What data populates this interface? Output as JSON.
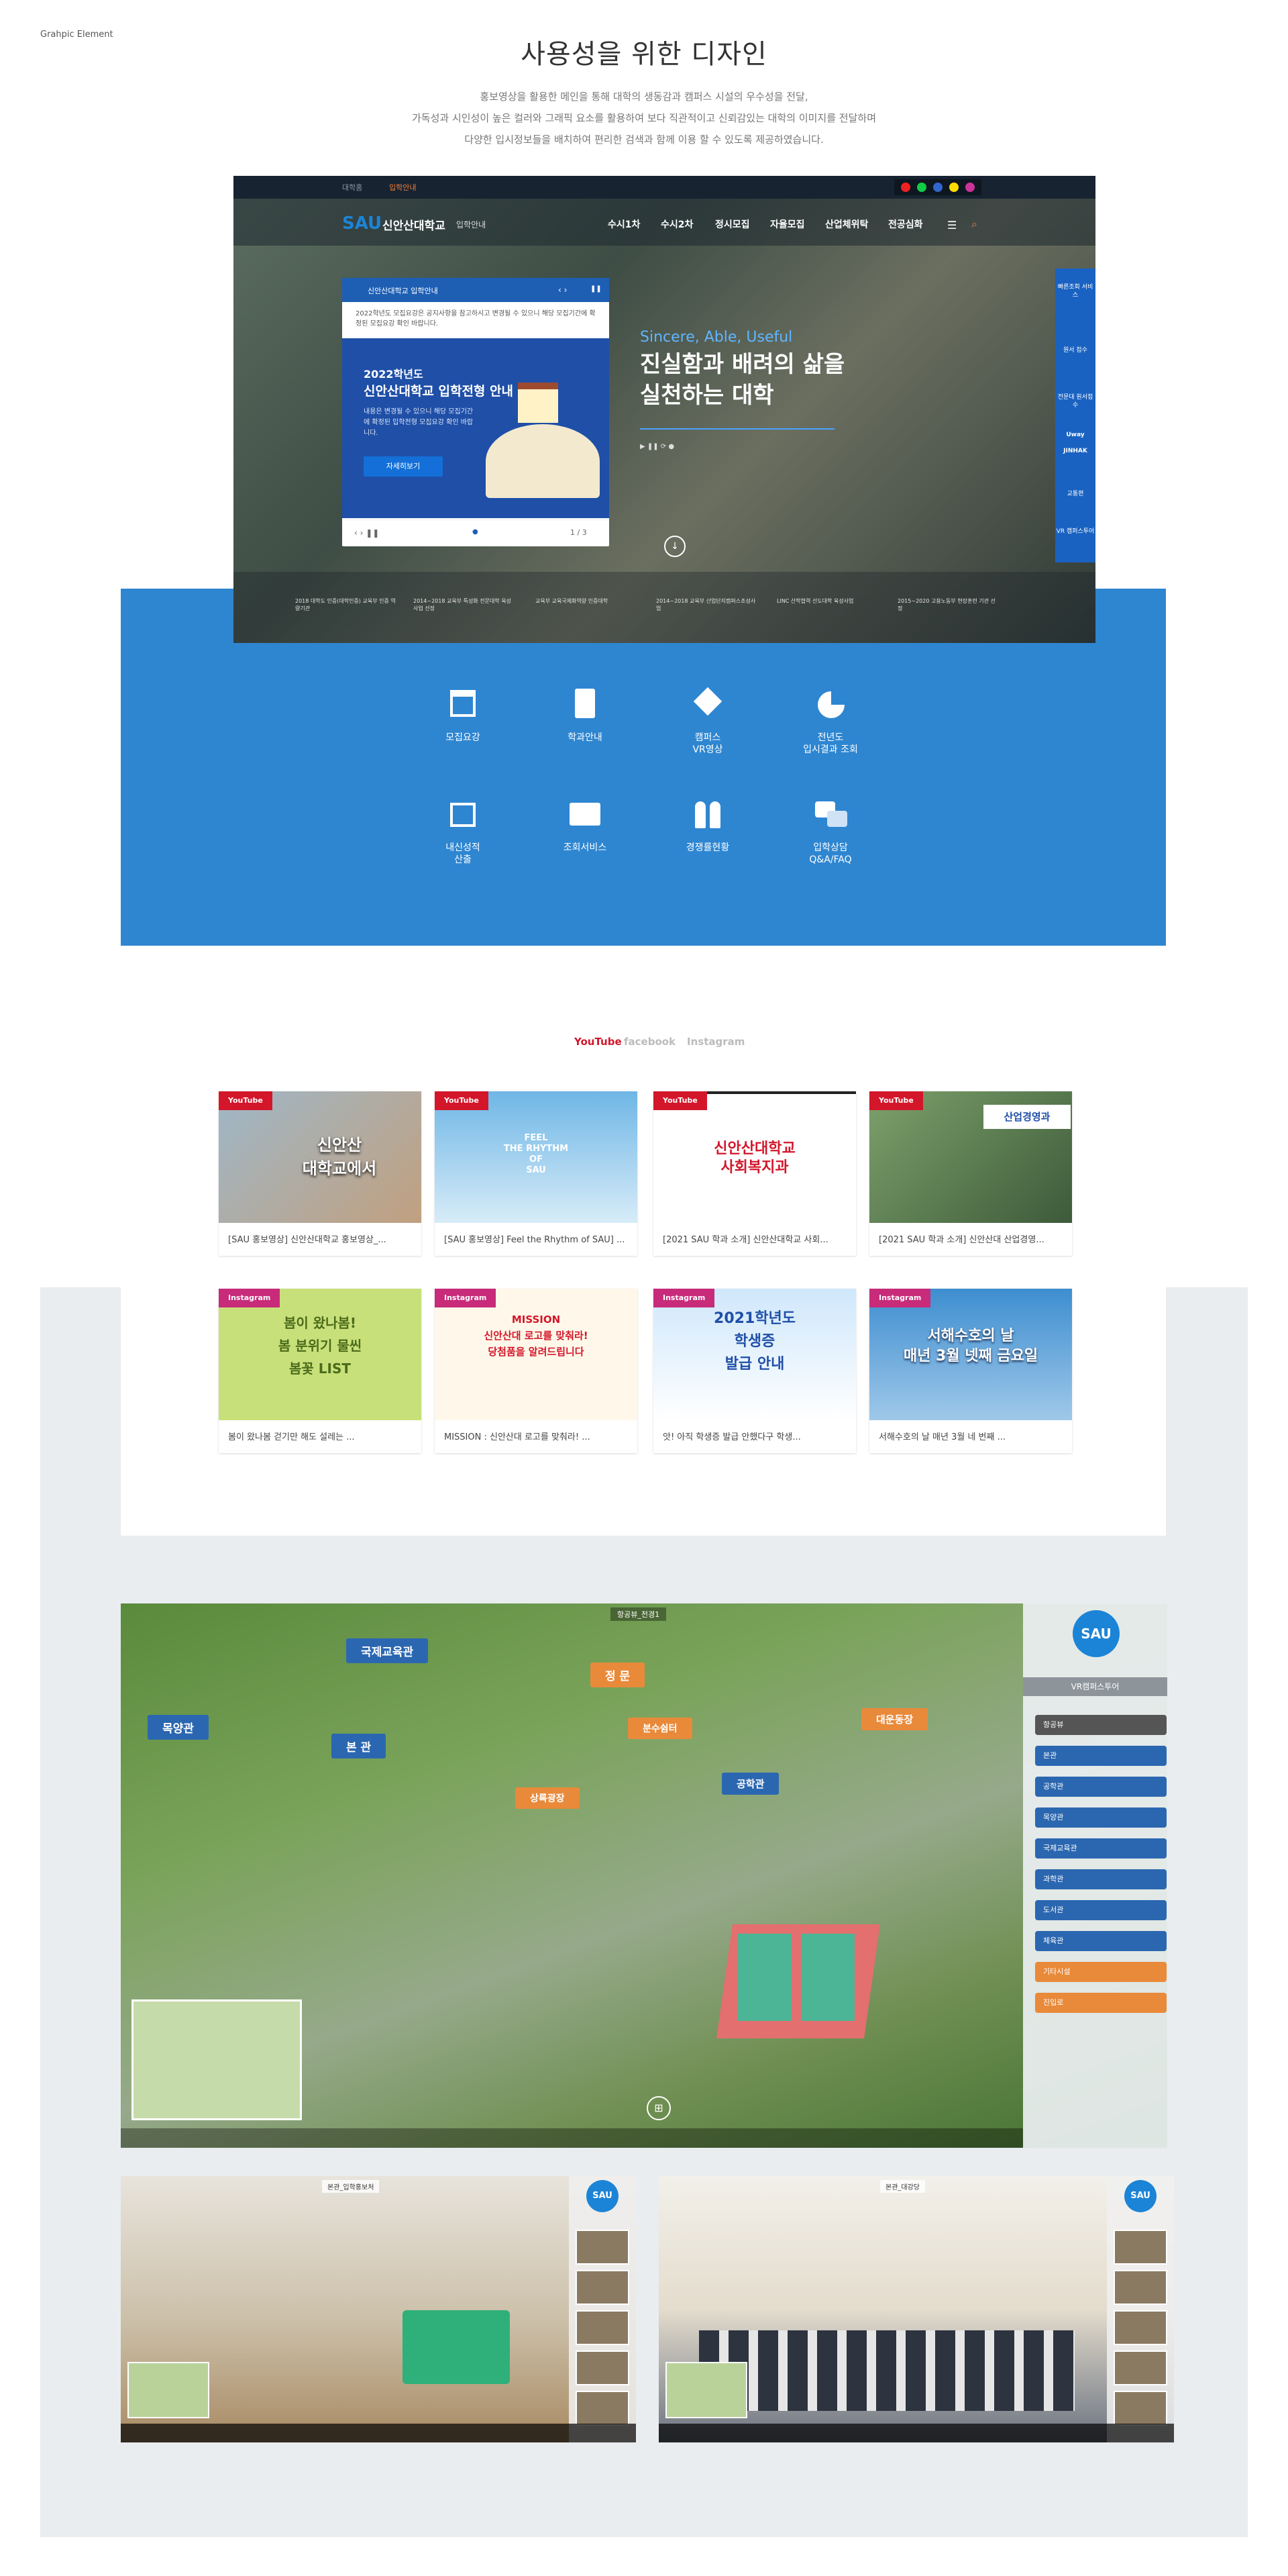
{
  "section_label": "Grahpic Element",
  "heading": "사용성을 위한 디자인",
  "desc": [
    "홍보영상을 활용한 메인을 통해 대학의 생동감과 캠퍼스 시설의 우수성을 전달,",
    "가독성과 시인성이 높은 컬러와 그래픽 요소를 활용하여 보다 직관적이고 신뢰감있는 대학의 이미지를 전달하며",
    "다양한 입시정보들을 배치하여 편리한 검색과 함께 이용 할 수 있도록 제공하였습니다."
  ],
  "hero": {
    "topbar": [
      "대학홈",
      "입학안내"
    ],
    "logo_mark": "SAU",
    "logo_name": "신안산대학교",
    "logo_sub": "입학안내",
    "nav": [
      "수시1차",
      "수시2차",
      "정시모집",
      "자율모집",
      "산업체위탁",
      "전공심화"
    ],
    "card_title": "신안산대학교 입학안내",
    "card_notice": "2022학년도 모집요강은 공지사항을 참고하시고 변경될 수 있으니 해당 모집기간에 확정된 모집요강 확인 바랍니다.",
    "poster_year": "2022학년도",
    "poster_title": "신안산대학교 입학전형 안내",
    "poster_desc": "내용은 변경될 수 있으니 해당 모집기간에 확정된 입학전형 모집요강 확인 바랍니다.",
    "poster_btn": "자세히보기",
    "card_page": "1 / 3",
    "slogan_sub": "Sincere, Able, Useful",
    "slogan_1": "진실함과 배려의 삶을",
    "slogan_2": "실천하는 대학",
    "sidebar": [
      "빠른조회 서비스",
      "원서 접수",
      "전문대 원서접수",
      "Uway",
      "JINHAK",
      "교통편",
      "VR 캠퍼스투어"
    ],
    "partners": [
      "2018 대학도 인증(대학인증) 교육부 인증 역량기관",
      "2014~2018 교육부 특성화 전문대학 육성사업 선정",
      "교육부 교육국제화역량 인증대학",
      "2014~2018 교육부 산업단지캠퍼스조성사업",
      "LINC 산학협력 선도대학 육성사업",
      "2015~2020 고용노동부 현장훈련 기관 선정"
    ]
  },
  "menu": [
    {
      "label": "모집요강"
    },
    {
      "label": "학과안내"
    },
    {
      "label": "캠퍼스\nVR영상"
    },
    {
      "label": "전년도\n입시결과 조회"
    },
    {
      "label": "내신성적\n산출"
    },
    {
      "label": "조회서비스"
    },
    {
      "label": "경쟁률현황"
    },
    {
      "label": "입학상담\nQ&A/FAQ"
    }
  ],
  "social_tabs": [
    "YouTube",
    "facebook",
    "Instagram"
  ],
  "youtube": [
    {
      "tag": "YouTube",
      "overlay": "신안산\n대학교에서",
      "caption": "[SAU 홍보영상] 신안산대학교 홍보영상_..."
    },
    {
      "tag": "YouTube",
      "overlay": "FEEL\nTHE RHYTHM\nOF\nSAU",
      "caption": "[SAU 홍보영상] Feel the Rhythm of SAU] ..."
    },
    {
      "tag": "YouTube",
      "overlay": "신안산대학교\n사회복지과",
      "caption": "[2021 SAU 학과 소개] 신안산대학교 사회..."
    },
    {
      "tag": "YouTube",
      "overlay": "산업경영과",
      "caption": "[2021 SAU 학과 소개] 신안산대 산업경영..."
    }
  ],
  "instagram": [
    {
      "tag": "Instagram",
      "overlay": "봄이 왔나봄!\n봄 분위기 물씬\n봄꽃 LIST",
      "caption": "봄이 왔나봄 걷기만 해도 설레는 ..."
    },
    {
      "tag": "Instagram",
      "overlay": "MISSION\n신안산대 로고를 맞춰라!\n당첨품을 알려드립니다",
      "caption": "MISSION : 신안산대 로고를 맞춰라! ..."
    },
    {
      "tag": "Instagram",
      "overlay": "2021학년도\n학생증\n발급 안내",
      "caption": "앗! 아직 학생증 발급 안했다구 학생..."
    },
    {
      "tag": "Instagram",
      "overlay": "서해수호의 날\n매년 3월 넷째 금요일",
      "caption": "서해수호의 날 매년 3월 네 번째 ..."
    }
  ],
  "campus": {
    "top_label": "항공뷰_전경1",
    "pins": [
      "국제교육관",
      "정 문",
      "목양관",
      "본 관",
      "분수쉼터",
      "대운동장",
      "상록광장",
      "공학관"
    ],
    "panel_title": "VR캠퍼스투어",
    "panel_items": [
      "항공뷰",
      "본관",
      "공학관",
      "목양관",
      "국제교육관",
      "과학관",
      "도서관",
      "체육관",
      "기타시설",
      "진입로"
    ]
  },
  "tour1_label": "본관_입학홍보처",
  "tour2_label": "본관_대강당"
}
